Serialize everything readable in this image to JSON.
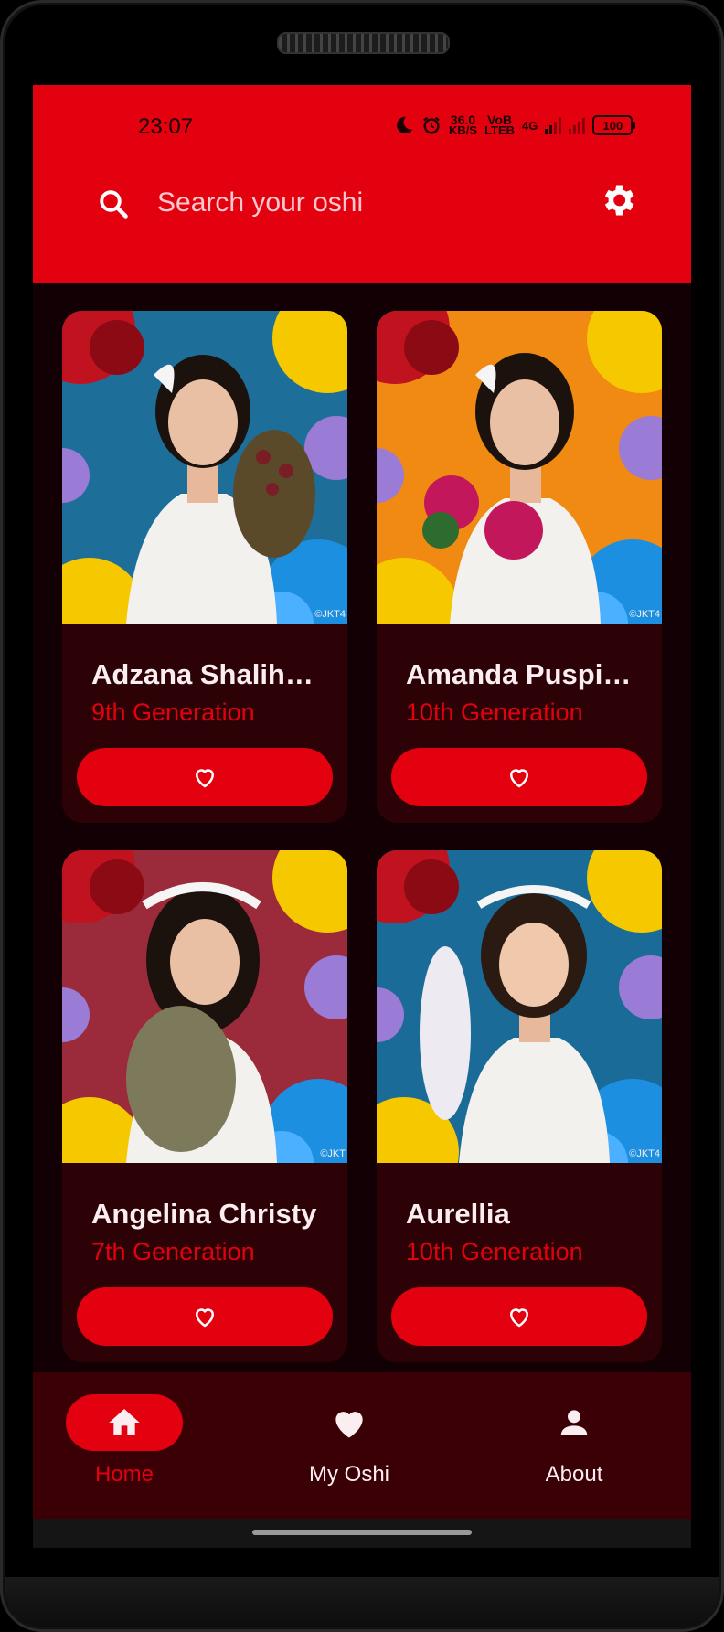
{
  "status_bar": {
    "time": "23:07",
    "net_speed_value": "36.0",
    "net_speed_unit": "KB/S",
    "volte_top": "VoB",
    "volte_bottom": "LTEB",
    "network_type": "4G",
    "battery": "100"
  },
  "search": {
    "placeholder": "Search your oshi"
  },
  "members": [
    {
      "name": "Adzana Shalih…",
      "generation": "9th Generation",
      "photo_bg": "#1d6f9a",
      "credit": "©JKT4"
    },
    {
      "name": "Amanda Puspi…",
      "generation": "10th Generation",
      "photo_bg": "#f08a12",
      "credit": "©JKT4"
    },
    {
      "name": "Angelina Christy",
      "generation": "7th Generation",
      "photo_bg": "#9b2a3a",
      "credit": "©JKT"
    },
    {
      "name": "Aurellia",
      "generation": "10th Generation",
      "photo_bg": "#1a6b97",
      "credit": "©JKT4"
    }
  ],
  "nav": {
    "home": "Home",
    "my_oshi": "My Oshi",
    "about": "About"
  },
  "colors": {
    "accent": "#E3010F",
    "background": "#120004",
    "card": "#2d0206",
    "nav_background": "#3a0006"
  }
}
